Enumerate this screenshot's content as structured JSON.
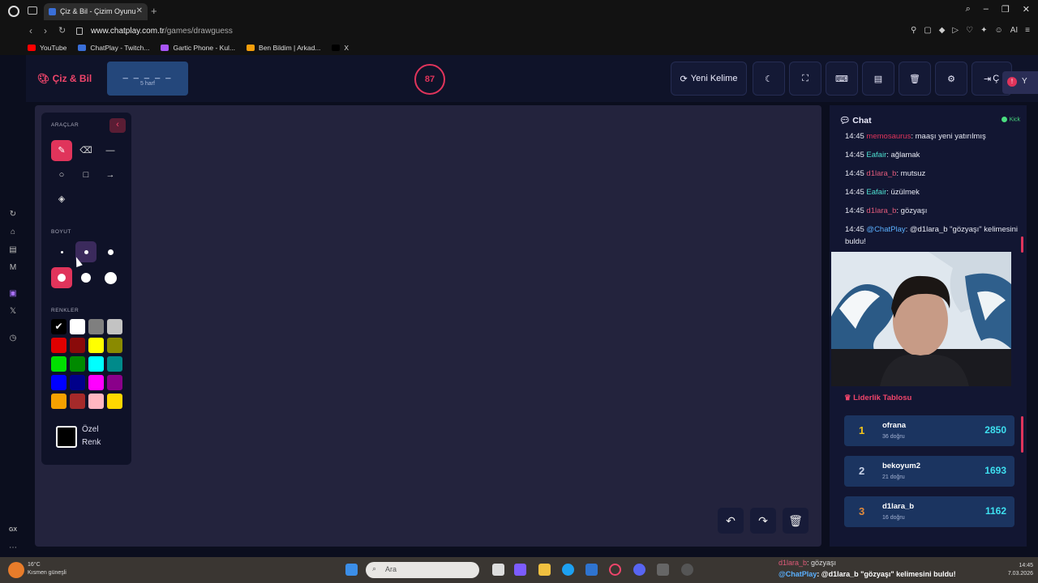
{
  "browser": {
    "tab_title": "Çiz & Bil - Çizim Oyunu",
    "url_domain": "www.chatplay.com.tr",
    "url_path": "/games/drawguess",
    "ai_label": "AI",
    "bookmarks": [
      {
        "label": "YouTube",
        "color": "#ff0000"
      },
      {
        "label": "ChatPlay - Twitch...",
        "color": "#3a6fd8"
      },
      {
        "label": "Gartic Phone - Kul...",
        "color": "#a855f7"
      },
      {
        "label": "Ben Bildim | Arkad...",
        "color": "#f59e0b"
      },
      {
        "label": "X",
        "color": "#000000"
      }
    ],
    "sidebar_gx": "GX"
  },
  "app": {
    "logo": "Çiz & Bil",
    "word_mask": "_ _ _ _ _",
    "word_hint": "5 harf",
    "timer": "87",
    "new_word_label": "Yeni Kelime",
    "exit_label": "Ç",
    "toast_label": "Y"
  },
  "tools": {
    "section_tools": "ARAÇLAR",
    "section_size": "BOYUT",
    "section_colors": "RENKLER",
    "custom_color_line1": "Özel",
    "custom_color_line2": "Renk",
    "colors": [
      "#000000",
      "#ffffff",
      "#7f7f7f",
      "#c3c3c3",
      "#e00000",
      "#8a0a0a",
      "#ffff00",
      "#8a8a00",
      "#00e000",
      "#008a00",
      "#00ffff",
      "#008a8a",
      "#0000ff",
      "#00008a",
      "#ff00ff",
      "#8a008a",
      "#f5a000",
      "#a52a2a",
      "#ffb6c1",
      "#ffd700"
    ]
  },
  "chat": {
    "title": "Chat",
    "platform": "Kick",
    "messages": [
      {
        "time": "14:45",
        "user": "memosaurus",
        "user_color": "#e0345b",
        "text": ": maaşı yeni yatırılmış"
      },
      {
        "time": "14:45",
        "user": "Eafair",
        "user_color": "#4ee0d0",
        "text": ": ağlamak"
      },
      {
        "time": "14:45",
        "user": "d1lara_b",
        "user_color": "#e05a7a",
        "text": ": mutsuz"
      },
      {
        "time": "14:45",
        "user": "Eafair",
        "user_color": "#4ee0d0",
        "text": ": üzülmek"
      },
      {
        "time": "14:45",
        "user": "d1lara_b",
        "user_color": "#e05a7a",
        "text": ": gözyaşı"
      },
      {
        "time": "14:45",
        "user": "@ChatPlay",
        "user_color": "#5ab0ff",
        "text": ": @d1lara_b \"gözyaşı\" kelimesini buldu!"
      }
    ]
  },
  "leaderboard": {
    "title": "Liderlik Tablosu",
    "rows": [
      {
        "rank": "1",
        "name": "ofrana",
        "sub": "36 doğru",
        "score": "2850",
        "rank_color": "#f5c518"
      },
      {
        "rank": "2",
        "name": "bekoyum2",
        "sub": "21 doğru",
        "score": "1693",
        "rank_color": "#c9d3e8"
      },
      {
        "rank": "3",
        "name": "d1lara_b",
        "sub": "16 doğru",
        "score": "1162",
        "rank_color": "#e08a3c"
      }
    ]
  },
  "taskbar": {
    "search_placeholder": "Ara",
    "weather_temp": "16°C",
    "weather_text": "Kısmen güneşli",
    "notif_line1_user": "d1lara_b",
    "notif_line1_text": ": gözyaşı",
    "notif_line2_user": "@ChatPlay",
    "notif_line2_text": ": @d1lara_b \"gözyaşı\" kelimesini buldu!",
    "clock_time": "14:45",
    "clock_date": "7.03.2026"
  }
}
